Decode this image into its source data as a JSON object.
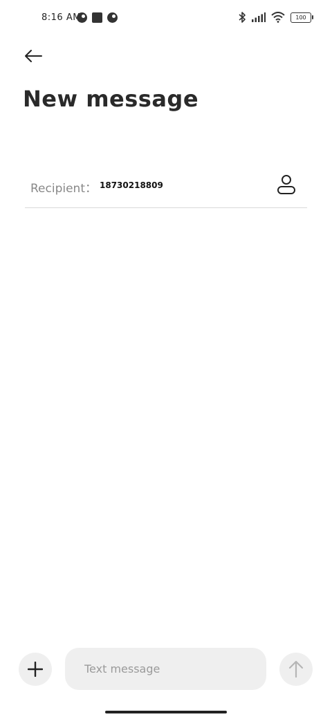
{
  "status_bar": {
    "time": "8:16 AM",
    "battery": "100",
    "icons": {
      "left": [
        "notification-circle-icon",
        "square-notification-icon",
        "notification-circle-icon"
      ],
      "right": [
        "bluetooth-icon",
        "signal-icon",
        "wifi-icon",
        "battery-icon"
      ]
    }
  },
  "header": {
    "back_icon": "arrow-left-icon",
    "title": "New message"
  },
  "recipient": {
    "label": "Recipient：",
    "value": "18730218809",
    "contact_icon": "person-icon"
  },
  "compose": {
    "add_icon": "plus-icon",
    "placeholder": "Text message",
    "send_icon": "arrow-up-icon"
  },
  "colors": {
    "background": "#ffffff",
    "input_background": "#efefef",
    "divider": "#d9d9d9",
    "muted_text": "#888888"
  }
}
